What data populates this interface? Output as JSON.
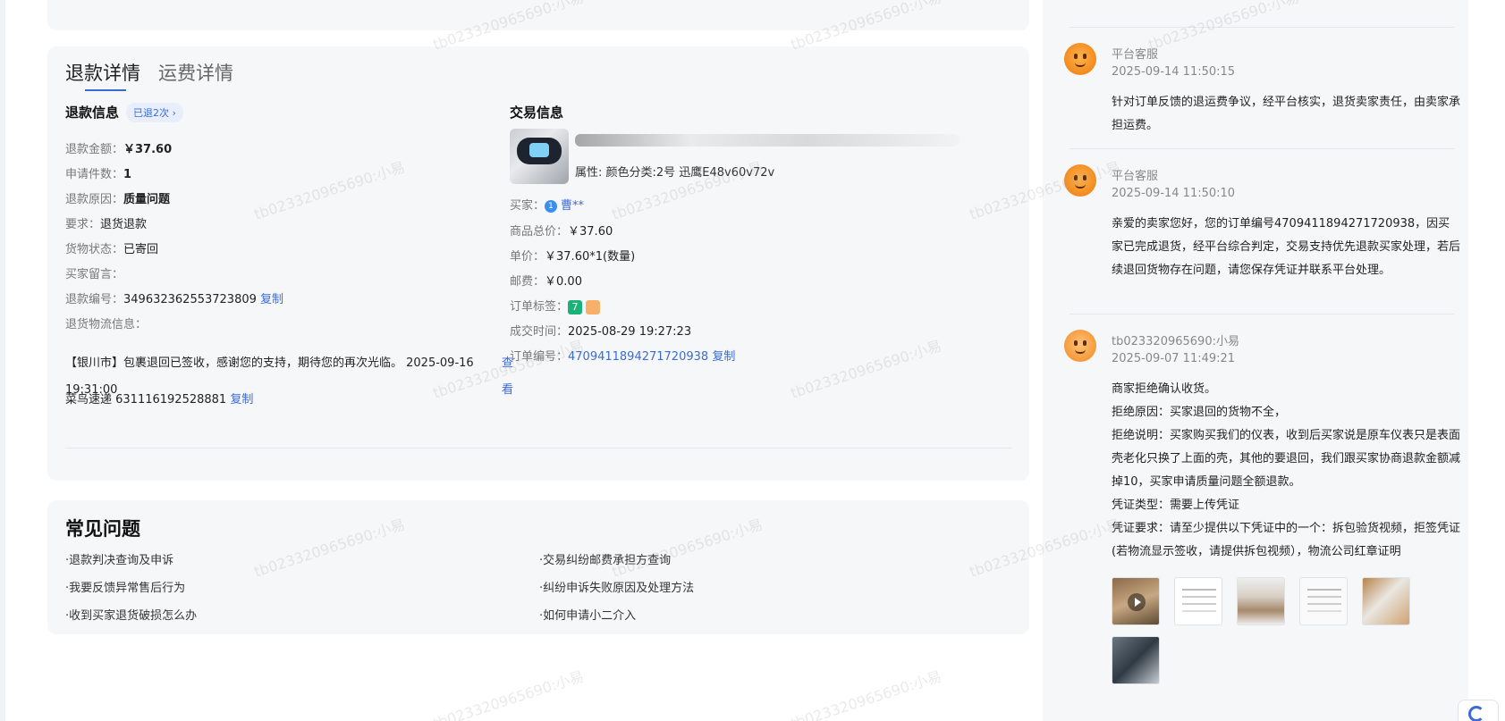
{
  "tabs": [
    {
      "label": "退款详情"
    },
    {
      "label": "运费详情"
    }
  ],
  "refund_info": {
    "title": "退款信息",
    "badge": "已退2次",
    "rows": [
      {
        "label": "退款金额：",
        "value": "￥37.60"
      },
      {
        "label": "申请件数：",
        "value": "1"
      },
      {
        "label": "退款原因：",
        "value": "质量问题"
      },
      {
        "label": "要求：",
        "value": "退货退款"
      },
      {
        "label": "货物状态：",
        "value": "已寄回"
      },
      {
        "label": "买家留言：",
        "value": ""
      },
      {
        "label": "退款编号：",
        "value": "349632362553723809"
      },
      {
        "label": "退货物流信息：",
        "value": ""
      }
    ],
    "copy_label": "复制",
    "logistics_text": "【银川市】包裹退回已签收，感谢您的支持，期待您的再次光临。 2025-09-16 19:31:00",
    "logistics_view": "查看",
    "carrier": "菜鸟速递 631116192528881",
    "carrier_copy": "复制"
  },
  "trade_info": {
    "title": "交易信息",
    "attributes": "属性: 颜色分类:2号 迅鹰E48v60v72v",
    "buyer_label": "买家：",
    "buyer_name": "曹**",
    "buyer_badge": "1",
    "total_label": "商品总价：",
    "total_value": "￥37.60",
    "unit_label": "单价：",
    "unit_value": "￥37.60*1(数量)",
    "postage_label": "邮费：",
    "postage_value": "￥0.00",
    "tags_label": "订单标签：",
    "tag1": "7",
    "deal_time_label": "成交时间：",
    "deal_time_value": "2025-08-29 19:27:23",
    "order_no_label": "订单编号：",
    "order_no_value": "4709411894271720938",
    "order_copy": "复制"
  },
  "faq": {
    "title": "常见问题",
    "items": [
      "·退款判决查询及申诉",
      "·交易纠纷邮费承担方查询",
      "·我要反馈异常售后行为",
      "·纠纷申诉失败原因及处理方法",
      "·收到买家退货破损怎么办",
      "·如何申请小二介入"
    ]
  },
  "messages": [
    {
      "name": "平台客服",
      "time": "2025-09-14 11:50:15",
      "body": "针对订单反馈的退运费争议，经平台核实，退货卖家责任，由卖家承担运费。"
    },
    {
      "name": "平台客服",
      "time": "2025-09-14 11:50:10",
      "body": "亲爱的卖家您好，您的订单编号4709411894271720938，因买家已完成退货，经平台综合判定，交易支持优先退款买家处理，若后续退回货物存在问题，请您保存凭证并联系平台处理。"
    },
    {
      "name": "tb023320965690:小易",
      "time": "2025-09-07 11:49:21",
      "lines": [
        "商家拒绝确认收货。",
        "拒绝原因：买家退回的货物不全，",
        "拒绝说明：买家购买我们的仪表，收到后买家说是原车仪表只是表面壳老化只换了上面的壳，其他的要退回，我们跟买家协商退款金额减掉10，买家申请质量问题全额退款。",
        "凭证类型：需要上传凭证",
        "凭证要求：请至少提供以下凭证中的一个：拆包验货视频，拒签凭证(若物流显示签收，请提供拆包视频），物流公司红章证明"
      ]
    }
  ],
  "watermark": "tb023320965690:小易",
  "colors": {
    "accent": "#3a6bd8",
    "card_bg": "#f6f7f9",
    "avatar_orange": "#f28a1e"
  }
}
